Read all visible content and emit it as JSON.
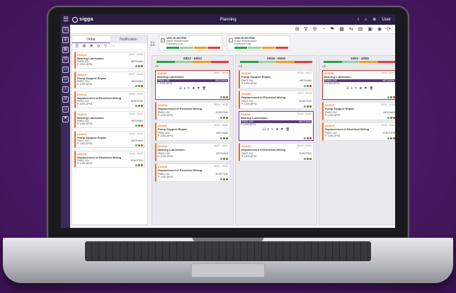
{
  "app": {
    "logo_text": "sigga",
    "title": "Planning",
    "top_right": [
      "i",
      "⌂",
      "⊕",
      "User"
    ]
  },
  "toolbar": {
    "icons": [
      "⊞",
      "∇",
      "⚙",
      "◔",
      "⚑",
      "▦",
      "⇆",
      "▤",
      "▣",
      "◉",
      "⟳"
    ]
  },
  "sidebar": {
    "icons": [
      "⊙",
      "◍",
      "▦",
      "⚙",
      "☷",
      "⛭",
      "⚠",
      "⚙",
      "☰",
      "⚑"
    ]
  },
  "left_panel": {
    "tabs": [
      "Order",
      "Notification"
    ],
    "tools": [
      "☰",
      "✥",
      "⚑",
      "⟳",
      "▽",
      "⋯"
    ],
    "orders": [
      {
        "id": "224111",
        "title": "Bearing Lubrication",
        "date": "04/07 - 04/08",
        "wc": "PM02-152",
        "type": "MECHANI",
        "loc": "P-1000-DP01"
      },
      {
        "id": "224112",
        "title": "Pump Support Repair",
        "date": "04/07 - 04/08",
        "wc": "PM02-152",
        "type": "MECHANI",
        "loc": "P-1000-DP01"
      },
      {
        "id": "224113",
        "title": "Replacement of Electrical Wiring",
        "date": "04/09 - 04/10",
        "wc": "PM02-152",
        "type": "ELEKTRIK",
        "loc": "P-1000-DP01"
      },
      {
        "id": "224114",
        "title": "Bearing Lubrication",
        "date": "04/10 - 04/11",
        "wc": "PM02-152",
        "type": "MECHANI",
        "loc": "P-1000-DP01"
      },
      {
        "id": "224115",
        "title": "Pump Support Repair",
        "date": "04/10 - 04/11",
        "wc": "PM02-152",
        "type": "MECHANI",
        "loc": "P-1000-DP01"
      },
      {
        "id": "224116",
        "title": "Replacement of Electrical Wiring",
        "date": "04/11 - 04/12",
        "wc": "PM02-152",
        "type": "ELEKTRIK",
        "loc": "P-1000-DP01"
      }
    ]
  },
  "summary_cards": [
    {
      "name": "1000-ELEKTRIK",
      "line1": "Elektr. Maintenance",
      "line2": "Expected Cost"
    },
    {
      "name": "1000-ELEKTRIK",
      "line1": "Elektr. Maintenance",
      "line2": "Expected Cost"
    }
  ],
  "columns": [
    {
      "title": "08/17 - 08/23",
      "all": "All",
      "cards": [
        {
          "id": "224100",
          "title": "Bearing Lubrication",
          "date": "08/17 - 08/18",
          "wc": "PM02-152",
          "type": "MECHANI",
          "loc": "P-1000-DP01",
          "selected": true
        },
        {
          "id": "224101",
          "title": "Replacement of Electrical Wiring",
          "date": "08/18 - 08/19",
          "wc": "PM02-152",
          "type": "ELEKTRIK",
          "loc": "P-1000-DP01"
        },
        {
          "id": "224102",
          "title": "Pump Support Repair",
          "date": "08/19 - 08/20",
          "wc": "PM02-152",
          "type": "MECHANI",
          "loc": "P-1000-DP01"
        },
        {
          "id": "224103",
          "title": "Bearing Lubrication",
          "date": "08/20 - 08/21",
          "wc": "PM02-152",
          "type": "MECHANI",
          "loc": "P-1000-DP01"
        },
        {
          "id": "224104",
          "title": "Replacement of Electrical Wiring",
          "date": "08/21 - 08/22",
          "wc": "PM02-152",
          "type": "ELEKTRIK",
          "loc": "P-1000-DP01"
        }
      ]
    },
    {
      "title": "09/26 - 09/30",
      "all": "All",
      "cards": [
        {
          "id": "224105",
          "title": "Pump Support Repair",
          "date": "09/26 - 09/27",
          "wc": "PM02-152",
          "type": "MECHANI",
          "loc": "P-1000-DP01"
        },
        {
          "id": "224106",
          "title": "Replacement of Electrical Wiring",
          "date": "09/27 - 09/28",
          "wc": "PM02-152",
          "type": "ELEKTRIK",
          "loc": "P-1000-DP01"
        },
        {
          "id": "224108",
          "title": "Bearing Lubrication",
          "date": "09/28 - 09/29",
          "wc": "PM02-152",
          "type": "MECHANI",
          "loc": "P-1000-DP01",
          "selected": true,
          "purple": true
        },
        {
          "id": "224107",
          "title": "Replacement of Electrical Wiring",
          "date": "09/29 - 09/30",
          "wc": "PM02-152",
          "type": "ELEKTRIK",
          "loc": "P-1000-DP01"
        }
      ]
    },
    {
      "title": "10/01 - 10/05",
      "all": "All",
      "cards": [
        {
          "id": "224109",
          "title": "Bearing Lubrication",
          "date": "10/01 - 10/02",
          "wc": "PM02-152",
          "type": "MECHANI",
          "loc": "P-1000-DP01",
          "selected": true
        },
        {
          "id": "224110",
          "title": "Pump Support Repair",
          "date": "10/02 - 10/03",
          "wc": "PM02-152",
          "type": "MECHANI",
          "loc": "P-1000-DP01"
        },
        {
          "id": "224113",
          "title": "Replacement of Electrical Wiring",
          "date": "10/03 - 10/04",
          "wc": "PM02-152",
          "type": "ELEKTRIK",
          "loc": "P-1000-DP01"
        }
      ]
    }
  ],
  "actions": [
    "☑",
    "ℹ",
    "✎",
    "✥",
    "⚑",
    "🗑"
  ],
  "colors": {
    "accent": "#f06a20",
    "brand": "#2b1d45",
    "selected_red": "#c0392b",
    "selected_purple": "#7a3c9a",
    "ok": "#2fa04a"
  }
}
